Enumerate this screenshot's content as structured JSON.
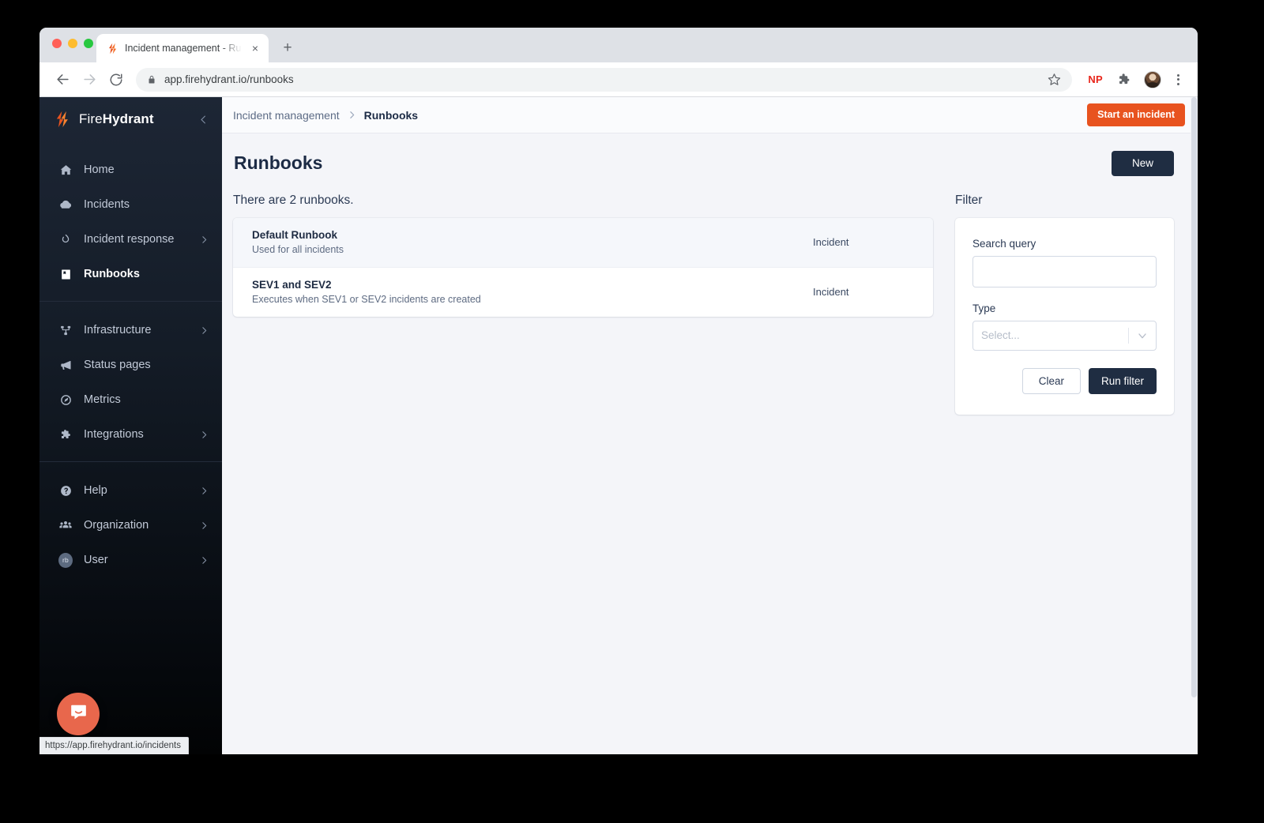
{
  "browser": {
    "tab": {
      "title": "Incident management - Runbooks",
      "favicon": "firehydrant-logo-icon",
      "close": "×"
    },
    "new_tab": "+",
    "back": "←",
    "forward": "→",
    "reload": "⟳",
    "url": "app.firehydrant.io/runbooks",
    "lock": "lock-icon",
    "star": "star-icon",
    "extension_np": "NP",
    "extension_puzzle": "puzzle-icon",
    "menu": "kebab-menu-icon",
    "status_url": "https://app.firehydrant.io/incidents"
  },
  "sidebar": {
    "brand_light": "Fire",
    "brand_bold": "Hydrant",
    "collapse": "chevron-left-icon",
    "groups": [
      {
        "items": [
          {
            "label": "Home",
            "icon": "home-icon",
            "active": false,
            "arrow": ""
          },
          {
            "label": "Incidents",
            "icon": "incidents-cloud-icon",
            "active": false,
            "arrow": ""
          },
          {
            "label": "Incident response",
            "icon": "fire-icon",
            "active": false,
            "arrow": "›"
          },
          {
            "label": "Runbooks",
            "icon": "book-icon",
            "active": true,
            "arrow": ""
          }
        ]
      },
      {
        "items": [
          {
            "label": "Infrastructure",
            "icon": "sitemap-icon",
            "active": false,
            "arrow": "›"
          },
          {
            "label": "Status pages",
            "icon": "megaphone-icon",
            "active": false,
            "arrow": ""
          },
          {
            "label": "Metrics",
            "icon": "gauge-icon",
            "active": false,
            "arrow": ""
          },
          {
            "label": "Integrations",
            "icon": "puzzle-piece-icon",
            "active": false,
            "arrow": "›"
          }
        ]
      },
      {
        "items": [
          {
            "label": "Help",
            "icon": "question-circle-icon",
            "active": false,
            "arrow": "›"
          },
          {
            "label": "Organization",
            "icon": "people-icon",
            "active": false,
            "arrow": "›"
          },
          {
            "label": "User",
            "icon": "user-avatar",
            "active": false,
            "arrow": "›",
            "avatar_initials": "rb"
          }
        ]
      }
    ],
    "intercom": "chat-bubble-icon"
  },
  "topbar": {
    "breadcrumb_parent": "Incident management",
    "breadcrumb_separator": "›",
    "breadcrumb_current": "Runbooks",
    "start_incident_label": "Start an incident"
  },
  "page": {
    "title": "Runbooks",
    "new_button": "New",
    "count_text": "There are 2 runbooks.",
    "runbooks": [
      {
        "name": "Default Runbook",
        "description": "Used for all incidents",
        "type": "Incident",
        "hovered": true
      },
      {
        "name": "SEV1 and SEV2",
        "description": "Executes when SEV1 or SEV2 incidents are created",
        "type": "Incident",
        "hovered": false
      }
    ]
  },
  "filter": {
    "heading": "Filter",
    "search_label": "Search query",
    "search_value": "",
    "search_placeholder": "",
    "type_label": "Type",
    "type_selected": "Select...",
    "type_arrow": "chevron-down-icon",
    "clear_label": "Clear",
    "run_label": "Run filter"
  },
  "colors": {
    "accent_orange": "#e8531f",
    "dark_navy": "#1f2d42",
    "sidebar_top": "#1d2635",
    "page_bg": "#f4f5f9",
    "intercom": "#e8674c"
  }
}
